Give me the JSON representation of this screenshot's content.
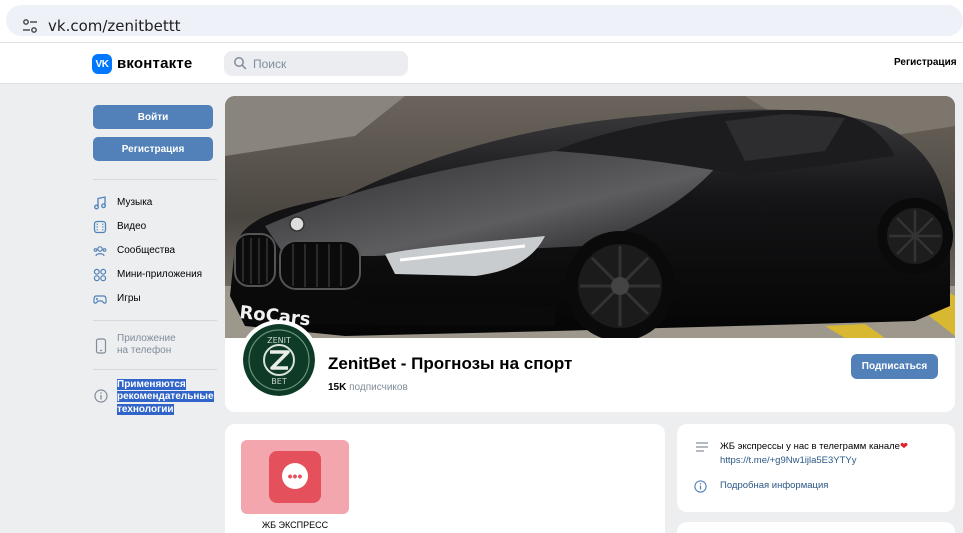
{
  "browser": {
    "url": "vk.com/zenitbettt"
  },
  "header": {
    "logo_mark": "VK",
    "logo_text": "вконтакте",
    "search_placeholder": "Поиск",
    "register_link": "Регистрация"
  },
  "sidebar": {
    "login_button": "Войти",
    "register_button": "Регистрация",
    "items": [
      {
        "label": "Музыка",
        "icon": "music-icon"
      },
      {
        "label": "Видео",
        "icon": "video-icon"
      },
      {
        "label": "Сообщества",
        "icon": "communities-icon"
      },
      {
        "label": "Мини-приложения",
        "icon": "mini-apps-icon"
      },
      {
        "label": "Игры",
        "icon": "games-icon"
      }
    ],
    "app_line1": "Приложение",
    "app_line2": "на телефон",
    "info_line1": "Применяются",
    "info_line2": "рекомендательные",
    "info_line3": "технологии"
  },
  "group": {
    "cover_watermark": "RoCars",
    "avatar_text_top": "ZENIT",
    "avatar_text_bottom": "BET",
    "title": "ZenitBet - Прогнозы на спорт",
    "subscribers_count": "15K",
    "subscribers_label": "подписчиков",
    "subscribe_button": "Подписаться"
  },
  "apps": {
    "tile_label": "ЖБ ЭКСПРЕСС"
  },
  "about": {
    "description": "ЖБ экспрессы у нас в телеграмм канале",
    "heart": "❤",
    "link": "https://t.me/+g9Nw1ijla5E3YTYy",
    "more_info": "Подробная информация"
  },
  "colors": {
    "accent": "#5181b8",
    "brand": "#0077ff",
    "page_bg": "#edeef0",
    "selection": "#3064c8"
  }
}
